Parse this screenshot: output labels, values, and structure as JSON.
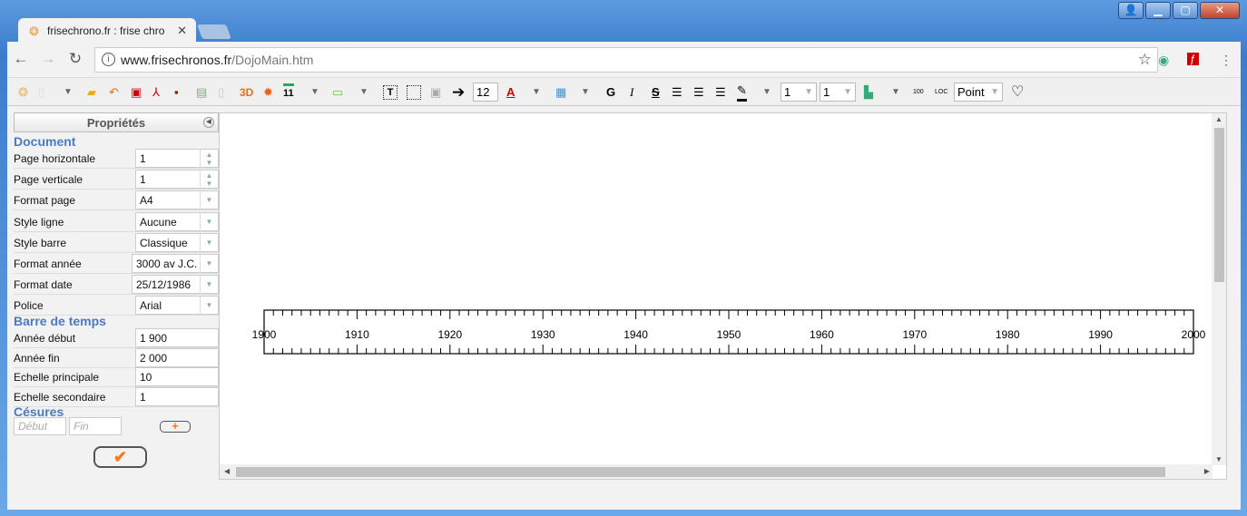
{
  "browser": {
    "tab_title": "frisechrono.fr : frise chro",
    "url_host": "www.frisechronos.fr",
    "url_path": "/DojoMain.htm"
  },
  "toolbar": {
    "font_size": "12",
    "line_width_1": "1",
    "line_width_2": "1",
    "point_style": "Point",
    "label_3d": "3D",
    "bold": "G",
    "italic": "I",
    "strike": "S",
    "calendar": "11"
  },
  "panel": {
    "title": "Propriétés",
    "document_heading": "Document",
    "document": [
      {
        "label": "Page horizontale",
        "value": "1",
        "control": "spinner"
      },
      {
        "label": "Page verticale",
        "value": "1",
        "control": "spinner"
      },
      {
        "label": "Format page",
        "value": "A4",
        "control": "select"
      },
      {
        "label": "Style ligne",
        "value": "Aucune",
        "control": "select"
      },
      {
        "label": "Style barre",
        "value": "Classique",
        "control": "select"
      },
      {
        "label": "Format année",
        "value": "3000 av J.C.",
        "control": "select"
      },
      {
        "label": "Format date",
        "value": "25/12/1986",
        "control": "select"
      },
      {
        "label": "Police",
        "value": "Arial",
        "control": "select"
      }
    ],
    "timebar_heading": "Barre de temps",
    "timebar": [
      {
        "label": "Année début",
        "value": "1 900"
      },
      {
        "label": "Année fin",
        "value": "2 000"
      },
      {
        "label": "Echelle principale",
        "value": "10"
      },
      {
        "label": "Echelle secondaire",
        "value": "1"
      }
    ],
    "cesures_heading": "Césures",
    "cesure_start_placeholder": "Début",
    "cesure_end_placeholder": "Fin"
  },
  "timeline": {
    "start": 1900,
    "end": 2000,
    "major": 10,
    "minor": 1,
    "labels": [
      "1900",
      "1910",
      "1920",
      "1930",
      "1940",
      "1950",
      "1960",
      "1970",
      "1980",
      "1990",
      "2000"
    ]
  },
  "colors": {
    "accent": "#4b7bbf",
    "action": "#f07c1c"
  }
}
